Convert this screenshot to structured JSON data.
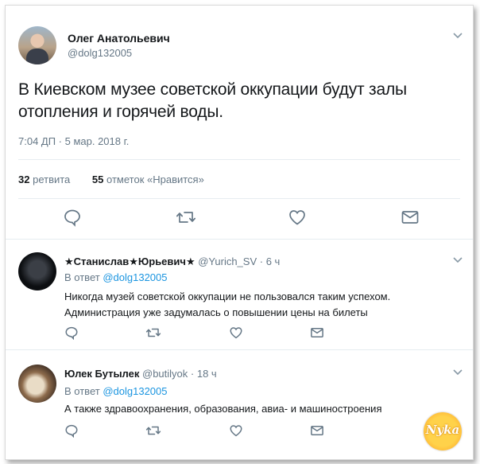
{
  "main_tweet": {
    "author_name": "Олег Анатольевич",
    "handle": "@dolg132005",
    "text": "В Киевском музее советской оккупации будут залы отопления и горячей воды.",
    "timestamp": "7:04 ДП · 5 мар. 2018 г.",
    "retweets_count": "32",
    "retweets_label": "ретвита",
    "likes_count": "55",
    "likes_label": "отметок «Нравится»"
  },
  "replies": [
    {
      "author_name": "★Станислав★Юрьевич★",
      "handle": "@Yurich_SV",
      "time": "· 6 ч",
      "in_reply_prefix": "В ответ",
      "in_reply_to": "@dolg132005",
      "text": "Никогда музей советской оккупации не пользовался таким успехом. Администрация уже задумалась о повышении цены на билеты"
    },
    {
      "author_name": "Юлек Бутылек",
      "handle": "@butilyok",
      "time": "· 18 ч",
      "in_reply_prefix": "В ответ",
      "in_reply_to": "@dolg132005",
      "text": "А также здравоохранения, образования, авиа- и машиностроения"
    }
  ],
  "watermark": {
    "text": "Nyka"
  },
  "colors": {
    "accent": "#1b95e0",
    "muted": "#657786",
    "icon": "#657786",
    "border": "#e6ecf0"
  },
  "icons": [
    "caret-down-icon",
    "reply-icon",
    "retweet-icon",
    "like-icon",
    "message-icon"
  ]
}
